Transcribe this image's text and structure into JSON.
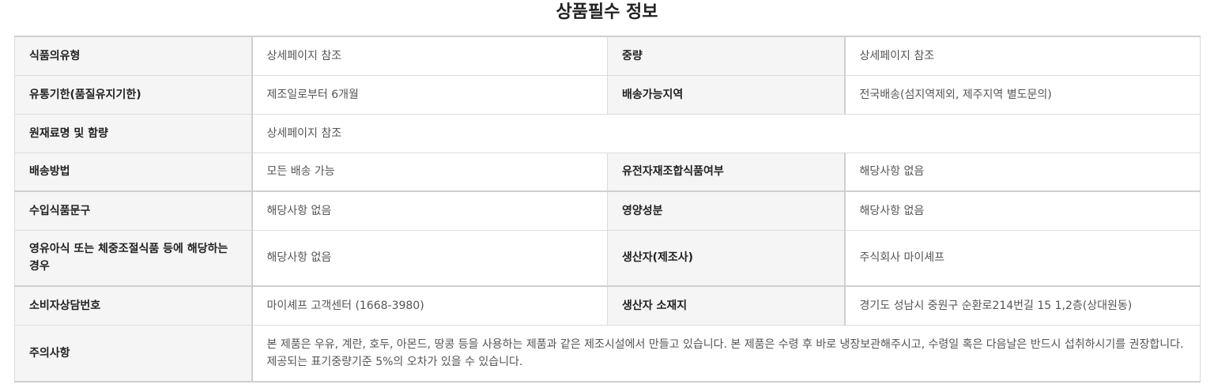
{
  "title": "상품필수 정보",
  "rows": [
    {
      "label1": "식품의유형",
      "value1": "상세페이지 참조",
      "label2": "중량",
      "value2": "상세페이지 참조"
    },
    {
      "label1": "유통기한(품질유지기한)",
      "value1": "제조일로부터 6개월",
      "label2": "배송가능지역",
      "value2": "전국배송(섬지역제외, 제주지역 별도문의)"
    },
    {
      "label1": "원재료명 및 함량",
      "value1": "상세페이지 참조"
    },
    {
      "label1": "배송방법",
      "value1": "모든 배송 가능",
      "label2": "유전자재조합식품여부",
      "value2": "해당사항 없음"
    },
    {
      "label1": "수입식품문구",
      "value1": "해당사항 없음",
      "label2": "영양성분",
      "value2": "해당사항 없음"
    },
    {
      "label1": "영유아식 또는 체중조절식품 등에 해당하는 경우",
      "value1": "해당사항 없음",
      "label2": "생산자(제조사)",
      "value2": "주식회사 마이셰프"
    },
    {
      "label1": "소비자상담번호",
      "value1": "마이셰프 고객센터 (1668-3980)",
      "label2": "생산자 소재지",
      "value2": "경기도 성남시 중원구 순환로214번길 15 1,2층(상대원동)"
    },
    {
      "label1": "주의사항",
      "value1": "본 제품은 우유, 계란, 호두, 아몬드, 땅콩 등을 사용하는 제품과 같은 제조시설에서 만들고 있습니다. 본 제품은 수령 후 바로 냉장보관해주시고, 수령일 혹은 다음날은 반드시 섭취하시기를 권장합니다. 제공되는 표기중량기준 5%의 오차가 있을 수 있습니다."
    }
  ]
}
